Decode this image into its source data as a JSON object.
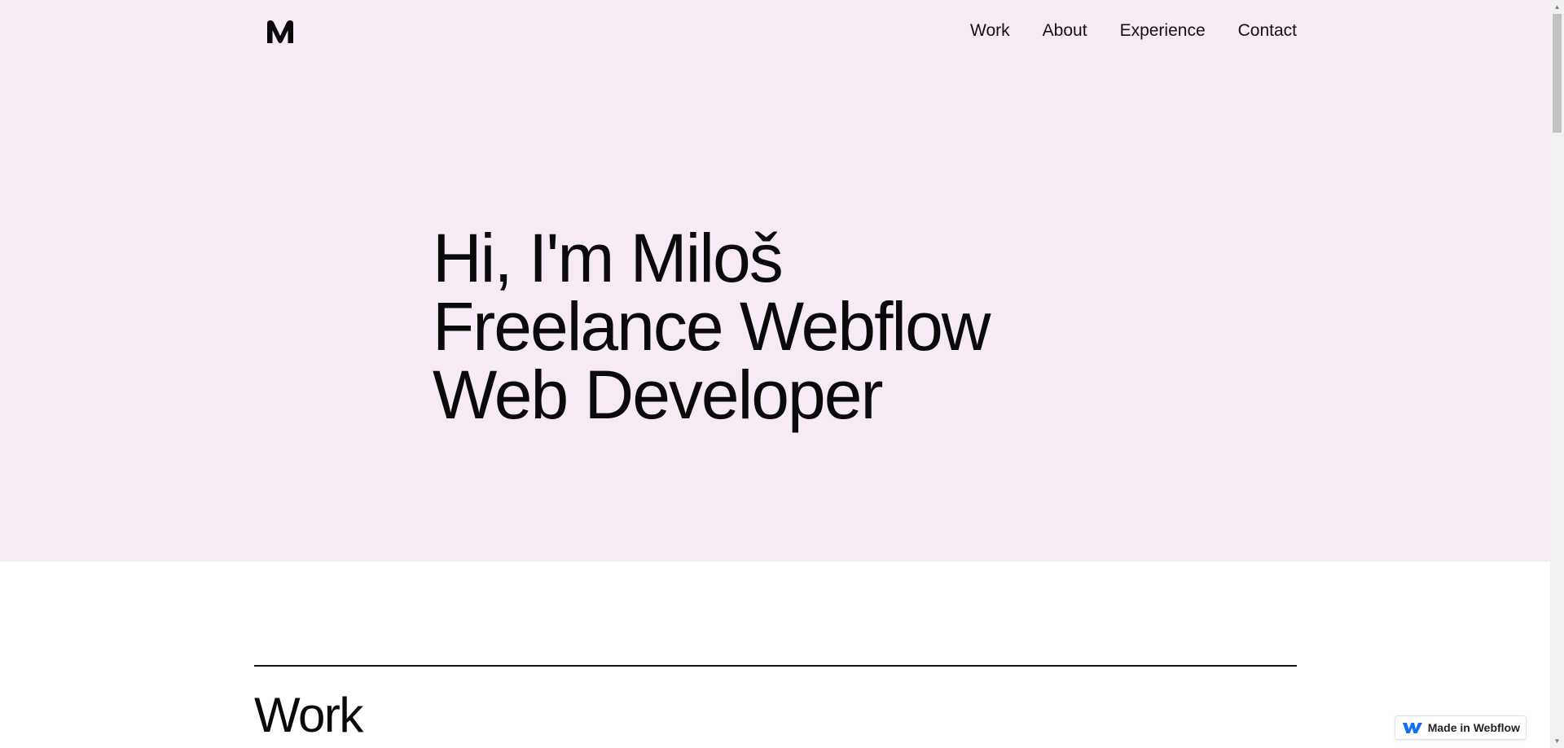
{
  "header": {
    "logo_letter": "M",
    "nav": [
      {
        "label": "Work"
      },
      {
        "label": "About"
      },
      {
        "label": "Experience"
      },
      {
        "label": "Contact"
      }
    ]
  },
  "hero": {
    "lines": [
      "Hi, I'm Miloš",
      "Freelance Webflow",
      "Web Developer"
    ]
  },
  "work": {
    "heading": "Work"
  },
  "badge": {
    "label": "Made in Webflow",
    "icon": "webflow-logo-icon"
  },
  "colors": {
    "hero_background": "#f6ebf5",
    "text": "#0a0a0a",
    "page_background": "#ffffff",
    "webflow_blue": "#146ef5"
  }
}
